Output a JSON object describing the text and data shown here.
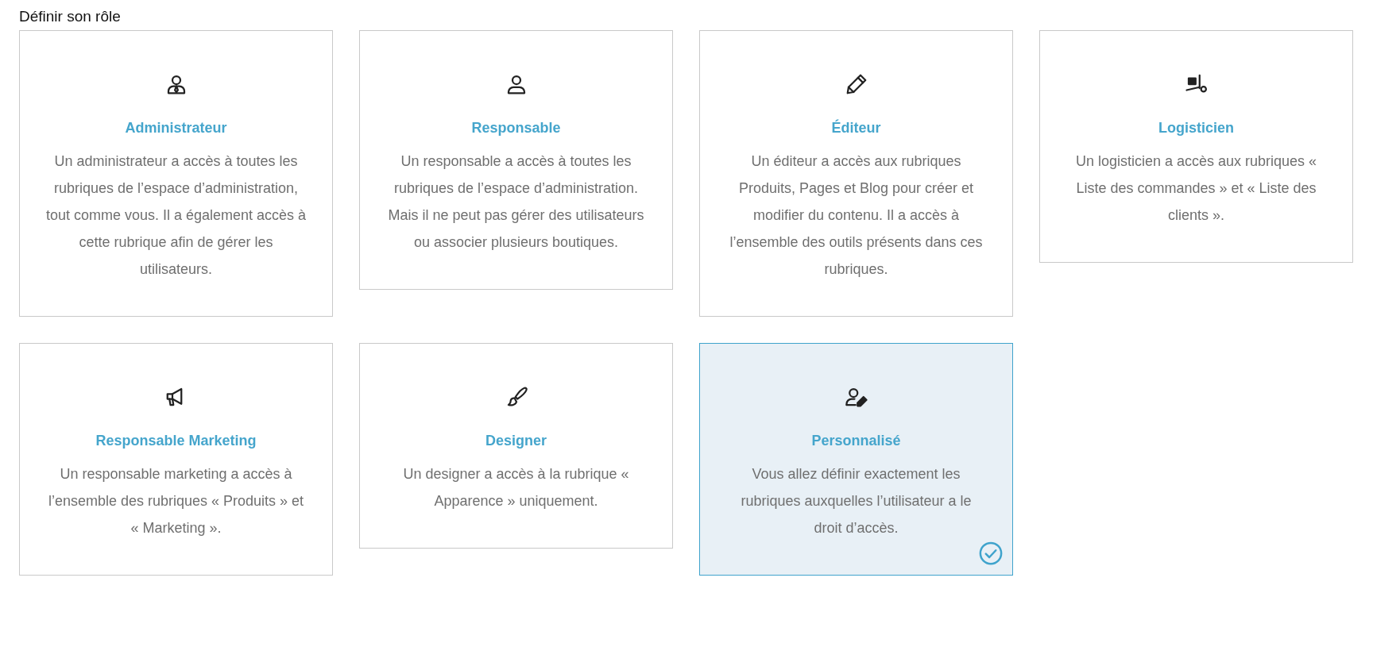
{
  "heading": "Définir son rôle",
  "roles": [
    {
      "title": "Administrateur",
      "description": "Un administrateur a accès à toutes les rubriques de l’espace d’administration, tout comme vous. Il a également accès à cette rubrique afin de gérer les utilisateurs.",
      "selected": false
    },
    {
      "title": "Responsable",
      "description": "Un responsable a accès à toutes les rubriques de l’espace d’administration. Mais il ne peut pas gérer des utilisateurs ou associer plusieurs boutiques.",
      "selected": false
    },
    {
      "title": "Éditeur",
      "description": "Un éditeur a accès aux rubriques Produits, Pages et Blog pour créer et modifier du contenu. Il a accès à l’ensemble des outils présents dans ces rubriques.",
      "selected": false
    },
    {
      "title": "Logisticien",
      "description": "Un logisticien a accès aux rubriques « Liste des commandes » et « Liste des clients ».",
      "selected": false
    },
    {
      "title": "Responsable Marketing",
      "description": "Un responsable marketing a accès à l’ensemble des rubriques « Produits » et « Marketing ».",
      "selected": false
    },
    {
      "title": "Designer",
      "description": "Un designer a accès à la rubrique « Apparence » uniquement.",
      "selected": false
    },
    {
      "title": "Personnalisé",
      "description": "Vous allez définir exactement les rubriques auxquelles l’utilisateur a le droit d’accès.",
      "selected": true
    }
  ]
}
